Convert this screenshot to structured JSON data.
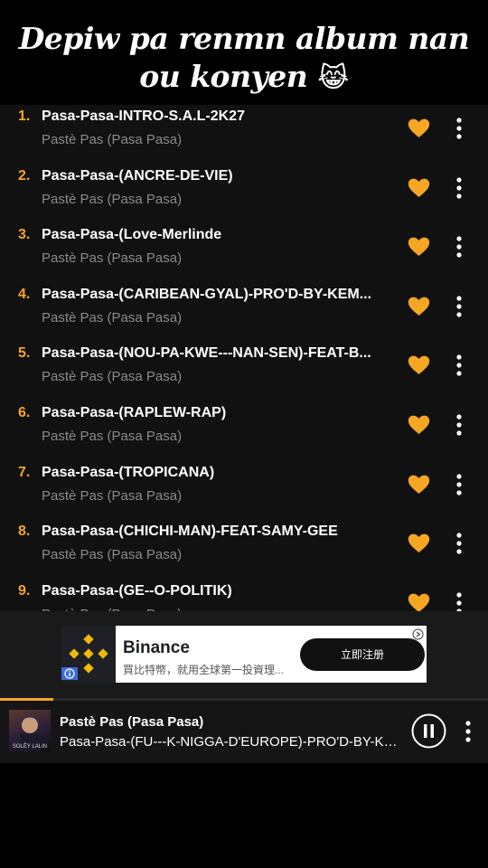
{
  "caption": {
    "line1": "Depiw pa renmn album nan",
    "line2": "ou konyen",
    "emoji": "😹"
  },
  "colors": {
    "accent": "#f5a623",
    "list_bg": "#111112",
    "player_bg": "#151515"
  },
  "tracks": [
    {
      "num": "1.",
      "title": "Pasa-Pasa-INTRO-S.A.L-2K27",
      "artist": "Pastè Pas (Pasa Pasa)",
      "favorite": true
    },
    {
      "num": "2.",
      "title": "Pasa-Pasa-(ANCRE-DE-VIE)",
      "artist": "Pastè Pas (Pasa Pasa)",
      "favorite": true
    },
    {
      "num": "3.",
      "title": "Pasa-Pasa-(Love-Merlinde",
      "artist": "Pastè Pas (Pasa Pasa)",
      "favorite": true
    },
    {
      "num": "4.",
      "title": "Pasa-Pasa-(CARIBEAN-GYAL)-PRO'D-BY-KEM...",
      "artist": "Pastè Pas (Pasa Pasa)",
      "favorite": true
    },
    {
      "num": "5.",
      "title": "Pasa-Pasa-(NOU-PA-KWE---NAN-SEN)-FEAT-B...",
      "artist": "Pastè Pas (Pasa Pasa)",
      "favorite": true
    },
    {
      "num": "6.",
      "title": "Pasa-Pasa-(RAPLEW-RAP)",
      "artist": "Pastè Pas (Pasa Pasa)",
      "favorite": true
    },
    {
      "num": "7.",
      "title": "Pasa-Pasa-(TROPICANA)",
      "artist": "Pastè Pas (Pasa Pasa)",
      "favorite": true
    },
    {
      "num": "8.",
      "title": "Pasa-Pasa-(CHICHI-MAN)-FEAT-SAMY-GEE",
      "artist": "Pastè Pas (Pasa Pasa)",
      "favorite": true
    },
    {
      "num": "9.",
      "title": "Pasa-Pasa-(GE--O-POLITIK)",
      "artist": "Pastè Pas (Pasa Pasa)",
      "favorite": true
    }
  ],
  "ad": {
    "brand": "Binance",
    "description": "買比特幣，就用全球第一投資理...",
    "cta": "立即注册"
  },
  "now_playing": {
    "artist": "Pastè Pas (Pasa Pasa)",
    "title": "Pasa-Pasa-(FU---K-NIGGA-D'EUROPE)-PRO'D-BY-KE...",
    "cover_text": "SOLÈY LALIN",
    "progress": 0.11,
    "state": "playing"
  },
  "icons": {
    "favorite": "heart-icon",
    "more": "more-vertical-icon",
    "pause": "pause-icon"
  }
}
